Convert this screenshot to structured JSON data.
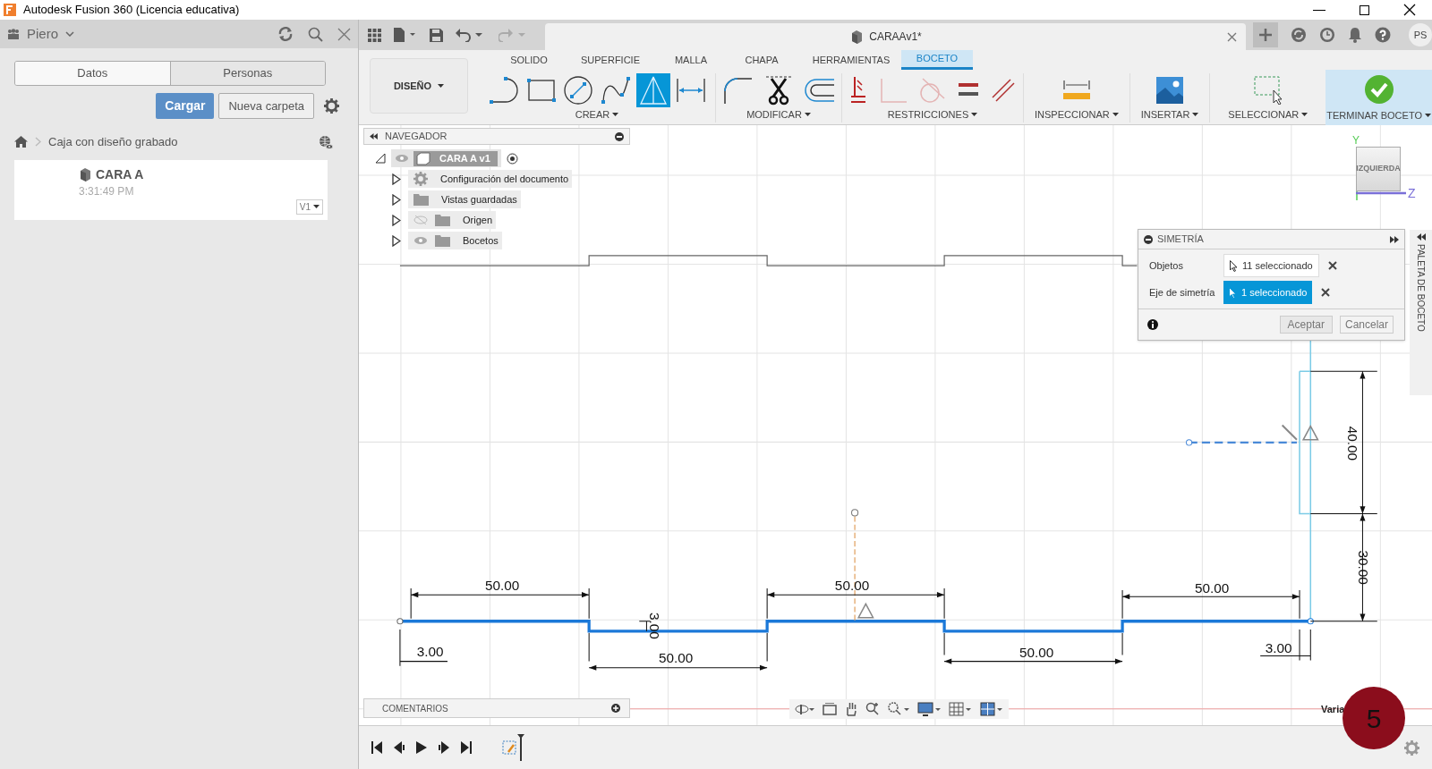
{
  "window": {
    "title": "Autodesk Fusion 360 (Licencia educativa)"
  },
  "data_panel": {
    "user": "Piero",
    "tabs": [
      {
        "label": "Datos",
        "selected": true
      },
      {
        "label": "Personas",
        "selected": false
      }
    ],
    "buttons": [
      "Cargar",
      "Nueva carpeta"
    ],
    "breadcrumb": "Caja con diseño grabado",
    "files": [
      {
        "name": "CARA A",
        "time": "3:31:49 PM",
        "version": "V1"
      }
    ]
  },
  "document_tab": {
    "title": "CARAAv1*",
    "user_initials": "PS"
  },
  "workspace": "DISEÑO",
  "toolbar_tabs": [
    {
      "label": "SOLIDO",
      "selected": false
    },
    {
      "label": "SUPERFICIE",
      "selected": false
    },
    {
      "label": "MALLA",
      "selected": false
    },
    {
      "label": "CHAPA",
      "selected": false
    },
    {
      "label": "HERRAMIENTAS",
      "selected": false
    },
    {
      "label": "BOCETO",
      "selected": true
    }
  ],
  "create_tools": [
    {
      "kind": "line",
      "selected": false
    },
    {
      "kind": "rectangle",
      "selected": false
    },
    {
      "kind": "circle",
      "selected": false
    },
    {
      "kind": "spline",
      "selected": false
    },
    {
      "kind": "mirror",
      "selected": true
    },
    {
      "kind": "dimension",
      "selected": false
    }
  ],
  "tool_groups": [
    "CREAR",
    "MODIFICAR",
    "RESTRICCIONES",
    "INSPECCIONAR",
    "INSERTAR",
    "SELECCIONAR",
    "TERMINAR BOCETO"
  ],
  "navigator": {
    "title": "NAVEGADOR",
    "root": "CARA A v1",
    "children": [
      {
        "label": "Configuración del documento",
        "kind": "settings"
      },
      {
        "label": "Vistas guardadas",
        "kind": "folder"
      },
      {
        "label": "Origen",
        "kind": "folder",
        "visible": false
      },
      {
        "label": "Bocetos",
        "kind": "folder",
        "visible": true
      }
    ]
  },
  "sketch_dimensions": [
    "40.00",
    "30.00",
    "50.00",
    "50.00",
    "50.00",
    "3.00",
    "3.00",
    "50.00",
    "50.00",
    "3.00"
  ],
  "viewcube": {
    "face": "IZQUIERDA",
    "axes": [
      "Y",
      "Z"
    ]
  },
  "dialog": {
    "title": "SIMETRÍA",
    "rows": [
      {
        "label": "Objetos",
        "value": "11 seleccionado",
        "selected": false
      },
      {
        "label": "Eje de simetría",
        "value": "1 seleccionado",
        "selected": true
      }
    ],
    "buttons": [
      "Aceptar",
      "Cancelar"
    ]
  },
  "palette_label": "PALETA DE BOCETO",
  "comments": "COMENTARIOS",
  "variables": "Varia",
  "step_badge": "5"
}
